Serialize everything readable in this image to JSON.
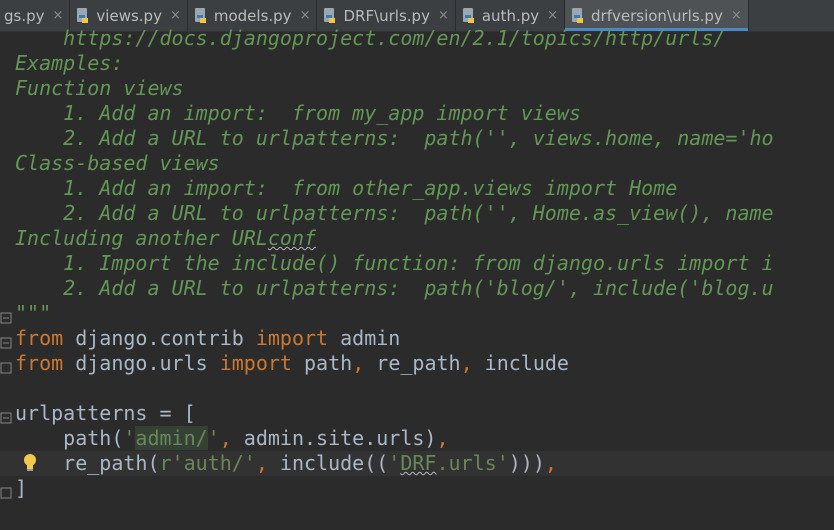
{
  "tabs": [
    {
      "label": "gs.py",
      "active": false
    },
    {
      "label": "views.py",
      "active": false
    },
    {
      "label": "models.py",
      "active": false
    },
    {
      "label": "DRF\\urls.py",
      "active": false
    },
    {
      "label": "auth.py",
      "active": false
    },
    {
      "label": "drfversion\\urls.py",
      "active": true
    }
  ],
  "tab_close_glyph": "×",
  "colors": {
    "background": "#2b2b2b",
    "docstring": "#629755",
    "keyword": "#cc7832",
    "string": "#6a8759",
    "identifier": "#a9b7c6",
    "active_tab_underline": "#4a88c7"
  },
  "icons": {
    "tab_file": "python-file-icon",
    "gutter_bulb": "lightbulb-icon",
    "gutter_fold": "fold-marker-icon"
  },
  "code": {
    "l1": "    https://docs.djangoproject.com/en/2.1/topics/http/urls/",
    "l2": "Examples:",
    "l3": "Function views",
    "l4": "    1. Add an import:  from my_app import views",
    "l5": "    2. Add a URL to urlpatterns:  path('', views.home, name='ho",
    "l6": "Class-based views",
    "l7": "    1. Add an import:  from other_app.views import Home",
    "l8": "    2. Add a URL to urlpatterns:  path('', Home.as_view(), name",
    "l9_a": "Including another URL",
    "l9_b": "conf",
    "l10": "    1. Import the include() function: from django.urls import i",
    "l11": "    2. Add a URL to urlpatterns:  path('blog/', include('blog.u",
    "l12": "\"\"\"",
    "l13_kw1": "from",
    "l13_mod": " django.contrib ",
    "l13_kw2": "import",
    "l13_name": " admin",
    "l14_kw1": "from",
    "l14_mod": " django.urls ",
    "l14_kw2": "import",
    "l14_n1": " path",
    "l14_c1": ",",
    "l14_n2": " re_path",
    "l14_c2": ",",
    "l14_n3": " include",
    "l16_a": "urlpatterns = [",
    "l17_a": "    path(",
    "l17_q1": "'",
    "l17_s": "admin/",
    "l17_q2": "'",
    "l17_c": ",",
    "l17_b": " admin.site.urls)",
    "l17_c2": ",",
    "l18_a": "    re_path(",
    "l18_s1": "r'auth/'",
    "l18_c": ",",
    "l18_b": " include((",
    "l18_q1": "'",
    "l18_s2a": "DRF",
    "l18_s2b": ".urls",
    "l18_q2": "'",
    "l18_e": ")))",
    "l18_c2": ",",
    "l19": "]"
  }
}
